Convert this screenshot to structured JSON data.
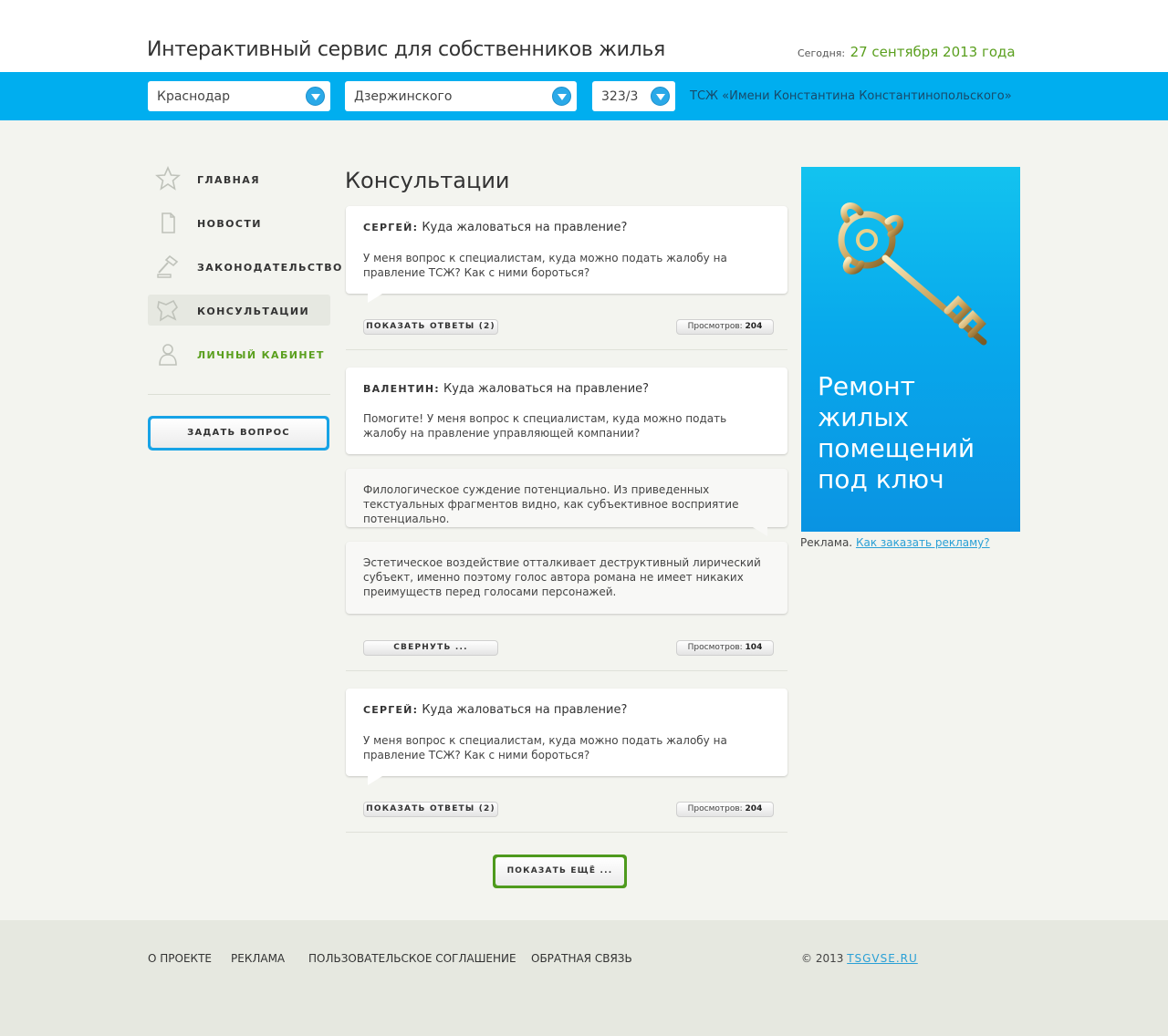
{
  "header": {
    "title": "Интерактивный сервис для собственников жилья",
    "today_label": "Сегодня:",
    "today_date": "27 сентября 2013 года"
  },
  "filters": {
    "city": "Краснодар",
    "street": "Дзержинского",
    "house": "323/3",
    "tsj": "ТСЖ «Имени Константина Константинопольского»"
  },
  "nav": {
    "items": [
      {
        "label": "ГЛАВНАЯ",
        "icon": "star-icon"
      },
      {
        "label": "НОВОСТИ",
        "icon": "document-icon"
      },
      {
        "label": "ЗАКОНОДАТЕЛЬСТВО",
        "icon": "gavel-icon"
      },
      {
        "label": "КОНСУЛЬТАЦИИ",
        "icon": "consult-icon"
      },
      {
        "label": "ЛИЧНЫЙ КАБИНЕТ",
        "icon": "user-icon"
      }
    ],
    "ask_button": "ЗАДАТЬ ВОПРОС"
  },
  "main": {
    "title": "Консультации",
    "questions": [
      {
        "author": "СЕРГЕЙ:",
        "subject": "Куда жаловаться на правление?",
        "text": "У меня вопрос к специалистам, куда можно подать жалобу на правление ТСЖ? Как с ними бороться?",
        "button": "ПОКАЗАТЬ ОТВЕТЫ (2)",
        "views_label": "Просмотров:",
        "views": "204"
      },
      {
        "author": "ВАЛЕНТИН:",
        "subject": "Куда жаловаться на правление?",
        "text": "Помогите! У меня вопрос к специалистам, куда можно подать жалобу на правление управляющей компании?",
        "answers": [
          "Филологическое суждение потенциально. Из приведенных текстуальных фрагментов видно, как субъективное восприятие потенциально.",
          "Эстетическое воздействие отталкивает деструктивный лирический субъект, именно поэтому голос автора романа не имеет никаких преимуществ перед голосами персонажей."
        ],
        "button": "СВЕРНУТЬ ...",
        "views_label": "Просмотров:",
        "views": "104"
      },
      {
        "author": "СЕРГЕЙ:",
        "subject": "Куда жаловаться на правление?",
        "text": "У меня вопрос к специалистам, куда можно подать жалобу на правление ТСЖ? Как с ними бороться?",
        "button": "ПОКАЗАТЬ ОТВЕТЫ (2)",
        "views_label": "Просмотров:",
        "views": "204"
      }
    ],
    "more_button": "ПОКАЗАТЬ ЕЩЁ ..."
  },
  "ad": {
    "text": "Ремонт жилых помещений под ключ",
    "note_label": "Реклама.",
    "note_link": "Как заказать рекламу?"
  },
  "footer": {
    "links": [
      "О ПРОЕКТЕ",
      "РЕКЛАМА",
      "ПОЛЬЗОВАТЕЛЬСКОЕ СОГЛАШЕНИЕ",
      "ОБРАТНАЯ СВЯЗЬ"
    ],
    "copyright": "© 2013",
    "site": "TSGVSE.RU"
  },
  "colors": {
    "accent_blue": "#00aeef",
    "accent_green": "#5a9f1e"
  }
}
